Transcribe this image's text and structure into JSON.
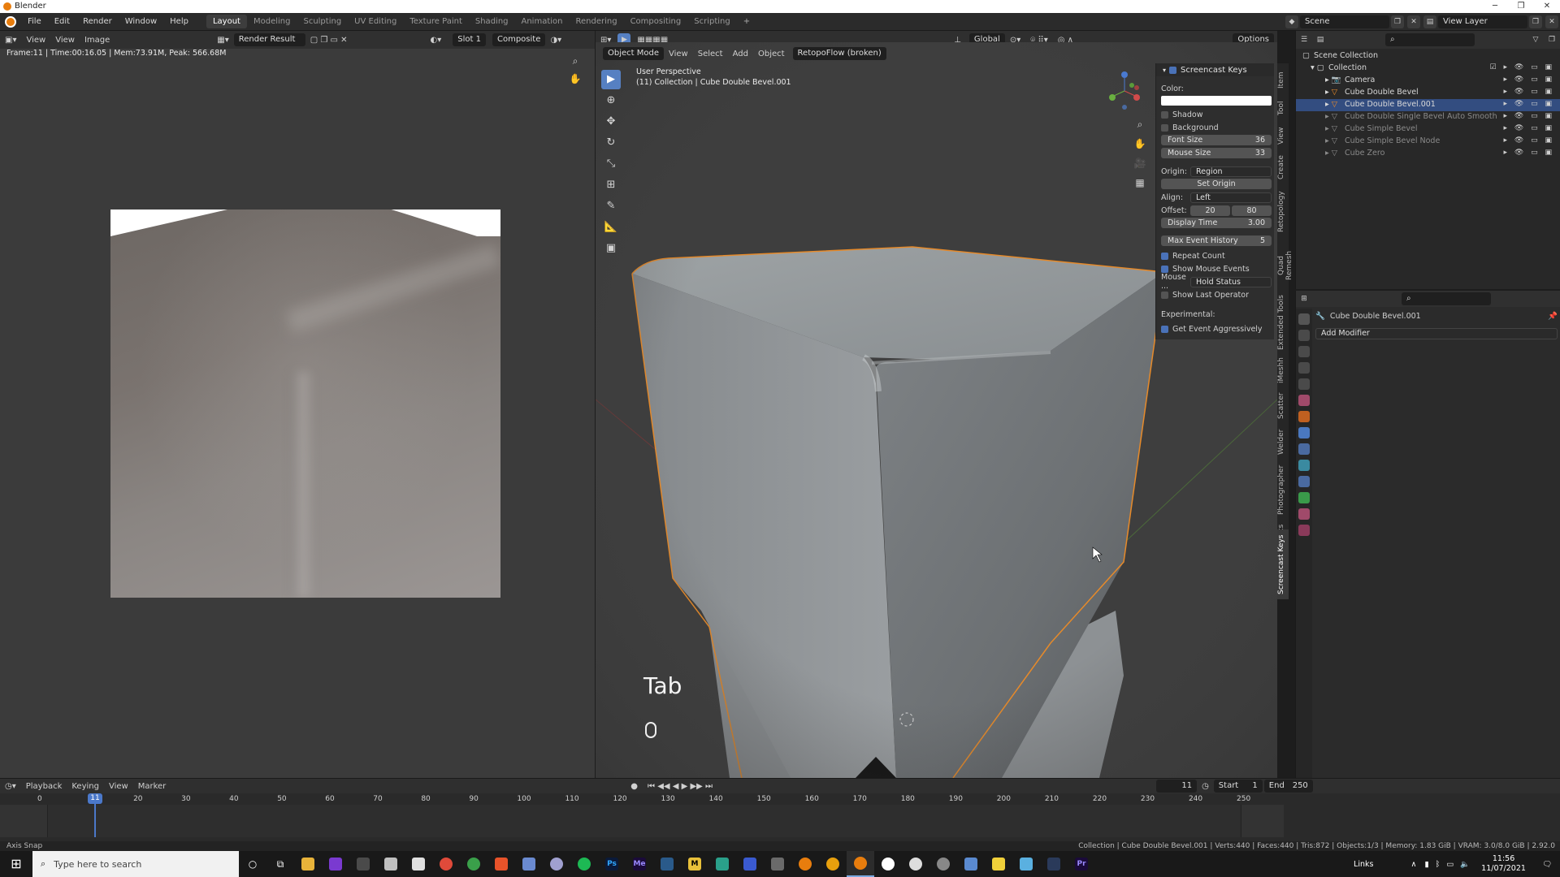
{
  "window": {
    "title": "Blender",
    "controls": [
      "─",
      "❐",
      "✕"
    ]
  },
  "menu": [
    "File",
    "Edit",
    "Render",
    "Window",
    "Help"
  ],
  "workspaces": [
    "Layout",
    "Modeling",
    "Sculpting",
    "UV Editing",
    "Texture Paint",
    "Shading",
    "Animation",
    "Rendering",
    "Compositing",
    "Scripting"
  ],
  "active_workspace": "Layout",
  "scene": {
    "label": "Scene",
    "view_layer": "View Layer"
  },
  "image_editor": {
    "view": "View",
    "menus": [
      "View",
      "Image"
    ],
    "image_name": "Render Result",
    "slot": "Slot 1",
    "composite": "Composite",
    "frame_info": "Frame:11 | Time:00:16.05 | Mem:73.91M, Peak: 566.68M"
  },
  "viewport": {
    "mode": "Object Mode",
    "menus": [
      "View",
      "Select",
      "Add",
      "Object"
    ],
    "addon_menu": "RetopoFlow (broken)",
    "transform": "Global",
    "options": "Options",
    "perspective": "User Perspective",
    "collection_line": "(11) Collection | Cube Double Bevel.001",
    "key_display": "Tab"
  },
  "screencast_keys": {
    "title": "Screencast Keys",
    "color_label": "Color:",
    "shadow": "Shadow",
    "background": "Background",
    "font_size_label": "Font Size",
    "font_size": "36",
    "mouse_size_label": "Mouse Size",
    "mouse_size": "33",
    "origin_label": "Origin:",
    "origin": "Region",
    "set_origin": "Set Origin",
    "align_label": "Align:",
    "align": "Left",
    "offset_label": "Offset:",
    "offset_x": "20",
    "offset_y": "80",
    "display_time_label": "Display Time",
    "display_time": "3.00",
    "max_event_label": "Max Event History",
    "max_event": "5",
    "repeat_count": "Repeat Count",
    "show_mouse": "Show Mouse Events",
    "mouse_label": "Mouse ...",
    "mouse_mode": "Hold Status",
    "show_last": "Show Last Operator",
    "experimental": "Experimental:",
    "get_event": "Get Event Aggressively"
  },
  "sidebar_tabs": [
    "Item",
    "Tool",
    "View",
    "Create",
    "Retopology",
    "Quad Remesh",
    "Extended Tools",
    "iMeshh",
    "Scatter",
    "Welder",
    "Photographer",
    "Physics",
    "Screencast Keys"
  ],
  "outliner": {
    "root": "Scene Collection",
    "items": [
      {
        "name": "Collection",
        "level": 1
      },
      {
        "name": "Camera",
        "level": 2
      },
      {
        "name": "Cube Double Bevel",
        "level": 2
      },
      {
        "name": "Cube Double Bevel.001",
        "level": 2,
        "selected": true
      },
      {
        "name": "Cube Double Single Bevel Auto Smooth",
        "level": 2
      },
      {
        "name": "Cube Simple Bevel",
        "level": 2
      },
      {
        "name": "Cube Simple Bevel Node",
        "level": 2
      },
      {
        "name": "Cube Zero",
        "level": 2
      }
    ]
  },
  "properties": {
    "object_name": "Cube Double Bevel.001",
    "add_modifier": "Add Modifier"
  },
  "timeline": {
    "menus": [
      "Playback",
      "Keying",
      "View",
      "Marker"
    ],
    "current_frame": "11",
    "start_label": "Start",
    "start": "1",
    "end_label": "End",
    "end": "250",
    "ticks": [
      "0",
      "11",
      "20",
      "30",
      "40",
      "50",
      "60",
      "70",
      "80",
      "90",
      "100",
      "110",
      "120",
      "130",
      "140",
      "150",
      "160",
      "170",
      "180",
      "190",
      "200",
      "210",
      "220",
      "230",
      "240",
      "250"
    ]
  },
  "status": {
    "left": "Axis Snap",
    "right": "Collection | Cube Double Bevel.001 | Verts:440 | Faces:440 | Tris:872 | Objects:1/3 | Memory: 1.83 GiB | VRAM: 3.0/8.0 GiB | 2.92.0"
  },
  "taskbar": {
    "search_placeholder": "Type here to search",
    "apps": [
      "Ps",
      "Me",
      "M",
      "Pr"
    ],
    "links": "Links",
    "time": "11:56",
    "date": "11/07/2021"
  }
}
